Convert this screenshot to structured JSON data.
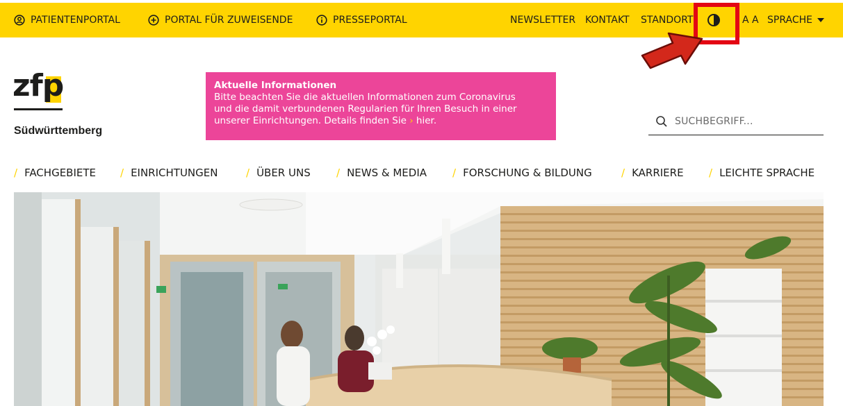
{
  "topbar": {
    "left_items": [
      {
        "label": "PATIENTENPORTAL",
        "icon": "person-circle-icon"
      },
      {
        "label": "PORTAL FÜR ZUWEISENDE",
        "icon": "plus-circle-icon"
      },
      {
        "label": "PRESSEPORTAL",
        "icon": "info-circle-icon"
      }
    ],
    "right_items": [
      {
        "label": "NEWSLETTER"
      },
      {
        "label": "KONTAKT"
      },
      {
        "label": "STANDORTE"
      }
    ],
    "font_size_label": "A A",
    "language_label": "SPRACHE",
    "contrast_icon": "contrast-icon",
    "background_color": "#ffd400"
  },
  "logo": {
    "mark_text": "zfp",
    "subtitle": "Südwürttemberg"
  },
  "info_box": {
    "title": "Aktuelle Informationen",
    "line1": "Bitte beachten Sie die aktuellen Informationen zum Coronavirus",
    "line2": "und die damit verbundenen Regularien für Ihren Besuch in einer",
    "line3": "unserer Einrichtungen. Details finden Sie",
    "link_glyph": "›",
    "link_text": "hier.",
    "background_color": "#ec4599"
  },
  "search": {
    "placeholder": "SUCHBEGRIFF..."
  },
  "main_nav": {
    "slash": "/",
    "items": [
      {
        "label": "FACHGEBIETE"
      },
      {
        "label": "EINRICHTUNGEN"
      },
      {
        "label": "ÜBER UNS"
      },
      {
        "label": "NEWS & MEDIA"
      },
      {
        "label": "FORSCHUNG & BILDUNG"
      },
      {
        "label": "KARRIERE"
      },
      {
        "label": "LEICHTE SPRACHE"
      }
    ]
  },
  "annotation": {
    "highlight_color": "#e30613"
  }
}
